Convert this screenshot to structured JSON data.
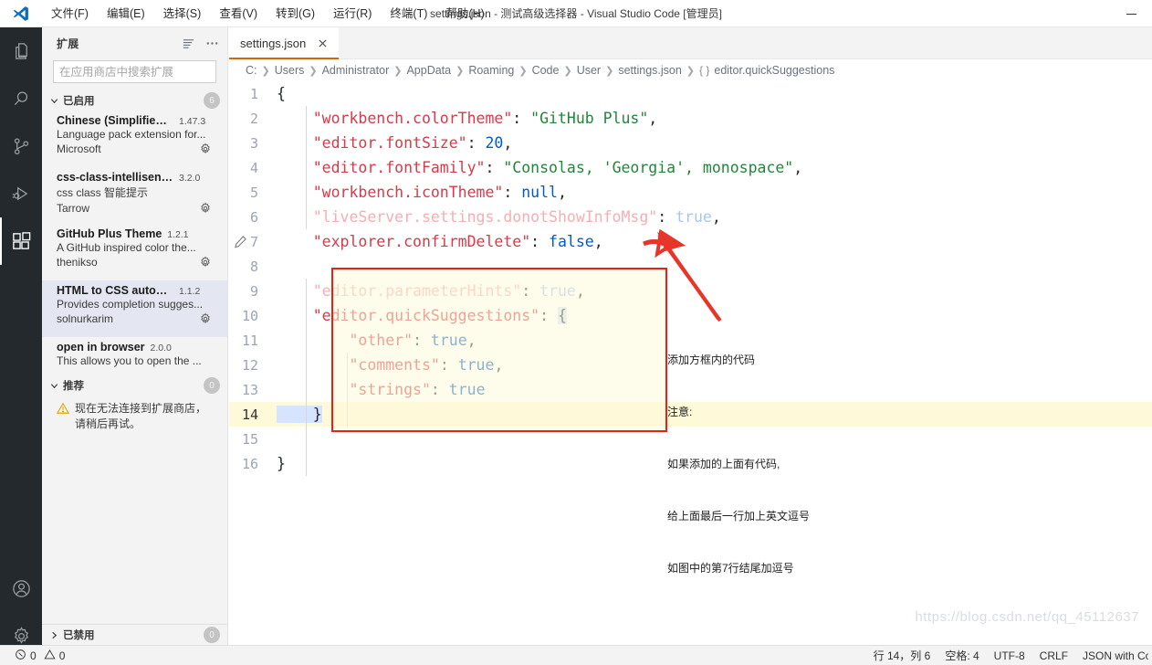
{
  "window": {
    "title": "settings.json - 测试高级选择器 - Visual Studio Code [管理员]",
    "minimize_label": "—"
  },
  "menubar": {
    "logo": "vscode-logo",
    "items": [
      {
        "label": "文件(F)"
      },
      {
        "label": "编辑(E)"
      },
      {
        "label": "选择(S)"
      },
      {
        "label": "查看(V)"
      },
      {
        "label": "转到(G)"
      },
      {
        "label": "运行(R)"
      },
      {
        "label": "终端(T)"
      },
      {
        "label": "帮助(H)"
      }
    ]
  },
  "activitybar": {
    "items": [
      {
        "name": "explorer-icon",
        "active": false
      },
      {
        "name": "search-icon",
        "active": false
      },
      {
        "name": "source-control-icon",
        "active": false
      },
      {
        "name": "run-debug-icon",
        "active": false
      },
      {
        "name": "extensions-icon",
        "active": true
      }
    ],
    "bottom": [
      {
        "name": "accounts-icon"
      },
      {
        "name": "settings-gear-icon"
      }
    ]
  },
  "sidebar": {
    "title": "扩展",
    "actions": [
      {
        "name": "filter-icon"
      },
      {
        "name": "more-actions-icon",
        "label": "..."
      }
    ],
    "search": {
      "placeholder": "在应用商店中搜索扩展",
      "value": ""
    },
    "enabled_section": {
      "label": "已启用",
      "badge": "6",
      "expanded": true
    },
    "extensions": [
      {
        "name": "Chinese (Simplified) ...",
        "version": "1.47.3",
        "description": "Language pack extension for...",
        "publisher": "Microsoft",
        "selected": false,
        "gear": true
      },
      {
        "name": "css-class-intellisense",
        "version": "3.2.0",
        "description": "css class 智能提示",
        "publisher": "Tarrow",
        "selected": false,
        "gear": true
      },
      {
        "name": "GitHub Plus Theme",
        "version": "1.2.1",
        "description": "A GitHub inspired color the...",
        "publisher": "thenikso",
        "selected": false,
        "gear": true
      },
      {
        "name": "HTML to CSS autoco...",
        "version": "1.1.2",
        "description": "Provides completion sugges...",
        "publisher": "solnurkarim",
        "selected": true,
        "gear": true
      },
      {
        "name": "open in browser",
        "version": "2.0.0",
        "description": "This allows you to open the ...",
        "publisher": "",
        "selected": false,
        "gear": false
      }
    ],
    "recommended_section": {
      "label": "推荐",
      "badge": "0",
      "expanded": true
    },
    "recommended_message": "现在无法连接到扩展商店，\n请稍后再试。",
    "disabled_section": {
      "label": "已禁用",
      "badge": "0",
      "expanded": false
    }
  },
  "editor": {
    "tabs": [
      {
        "label": "settings.json",
        "active": true,
        "close": "✕"
      }
    ],
    "breadcrumb": [
      "C:",
      "Users",
      "Administrator",
      "AppData",
      "Roaming",
      "Code",
      "User",
      "settings.json"
    ],
    "breadcrumb_symbol_icon": "{ }",
    "breadcrumb_symbol": "editor.quickSuggestions",
    "lines": [
      {
        "n": "1",
        "current": false
      },
      {
        "n": "2",
        "current": false
      },
      {
        "n": "3",
        "current": false
      },
      {
        "n": "4",
        "current": false
      },
      {
        "n": "5",
        "current": false
      },
      {
        "n": "6",
        "current": false
      },
      {
        "n": "7",
        "current": false
      },
      {
        "n": "8",
        "current": false
      },
      {
        "n": "9",
        "current": false
      },
      {
        "n": "10",
        "current": false
      },
      {
        "n": "11",
        "current": false
      },
      {
        "n": "12",
        "current": false
      },
      {
        "n": "13",
        "current": false
      },
      {
        "n": "14",
        "current": true
      },
      {
        "n": "15",
        "current": false
      },
      {
        "n": "16",
        "current": false
      }
    ],
    "code_text": [
      "{",
      "    \"workbench.colorTheme\": \"GitHub Plus\",",
      "    \"editor.fontSize\": 20,",
      "    \"editor.fontFamily\": \"Consolas, 'Georgia', monospace\",",
      "    \"workbench.iconTheme\": null,",
      "    \"liveServer.settings.donotShowInfoMsg\": true,",
      "    \"explorer.confirmDelete\": false,",
      "",
      "    \"editor.parameterHints\": true,",
      "    \"editor.quickSuggestions\": {",
      "        \"other\": true,",
      "        \"comments\": true,",
      "        \"strings\": true",
      "    }",
      "",
      "}"
    ]
  },
  "annotation": {
    "lines": [
      "添加方框内的代码",
      "注意:",
      "如果添加的上面有代码,",
      "给上面最后一行加上英文逗号",
      "如图中的第7行结尾加逗号"
    ],
    "box_color": "#e2231a",
    "arrow_color": "#e8352a"
  },
  "watermark": "https://blog.csdn.net/qq_45112637",
  "statusbar": {
    "errors": {
      "icon": "error-icon",
      "count": "0"
    },
    "warnings": {
      "icon": "warning-icon",
      "count": "0"
    },
    "cursor_position": "行 14，列 6",
    "indentation": "空格: 4",
    "encoding": "UTF-8",
    "eol": "CRLF",
    "language": "JSON with Comments"
  },
  "colors": {
    "activitybar_bg": "#24292e",
    "sidebar_bg": "#f3f3f3",
    "tab_accent": "#d16b00",
    "current_line": "#fdf9d9",
    "selection": "#e4e6f1"
  }
}
